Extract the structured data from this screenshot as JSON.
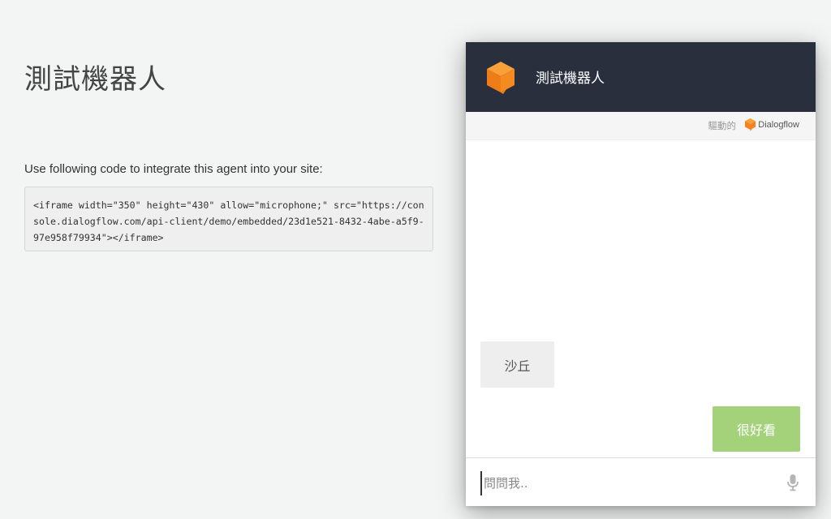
{
  "page": {
    "title": "測試機器人",
    "integrate_label": "Use following code to integrate this agent into your site:",
    "embed_code": "<iframe width=\"350\" height=\"430\" allow=\"microphone;\" src=\"https://console.dialogflow.com/api-client/demo/embedded/23d1e521-8432-4abe-a5f9-97e958f79934\"></iframe>"
  },
  "chat": {
    "agent_name": "測試機器人",
    "agent_icon": "orange-cube-icon",
    "powered_by": "驅動的",
    "brand_name": "Dialogflow",
    "brand_icon": "dialogflow-icon",
    "messages": [
      {
        "from": "bot",
        "text": "沙丘"
      },
      {
        "from": "user",
        "text": "很好看"
      }
    ],
    "input_placeholder": "問問我..",
    "mic_icon": "microphone-icon",
    "colors": {
      "header_bg": "#2a2f3e",
      "user_bubble": "#a3d27a",
      "bot_bubble": "#eeeeee",
      "accent_orange": "#f58220"
    }
  }
}
